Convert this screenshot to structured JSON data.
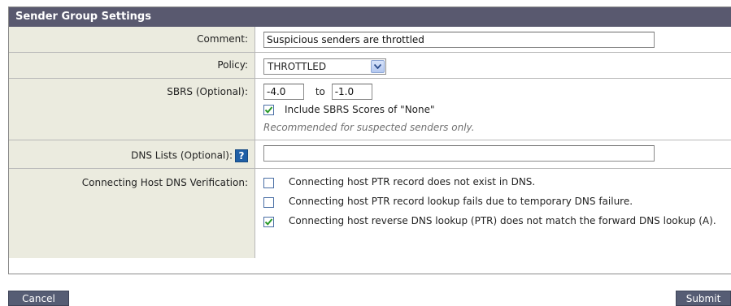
{
  "panel": {
    "title": "Sender Group Settings"
  },
  "comment": {
    "label": "Comment:",
    "value": "Suspicious senders are throttled"
  },
  "policy": {
    "label": "Policy:",
    "value": "THROTTLED"
  },
  "sbrs": {
    "label": "SBRS (Optional):",
    "min": "-4.0",
    "to_label": "to",
    "max": "-1.0",
    "include_none_label": "Include SBRS Scores of \"None\"",
    "include_none_checked": true,
    "hint": "Recommended for suspected senders only."
  },
  "dns_lists": {
    "label": "DNS Lists (Optional):",
    "value": "",
    "help_glyph": "?"
  },
  "host_verification": {
    "label": "Connecting Host DNS Verification:",
    "options": [
      {
        "label": "Connecting host PTR record does not exist in DNS.",
        "checked": false
      },
      {
        "label": "Connecting host PTR record lookup fails due to temporary DNS failure.",
        "checked": false
      },
      {
        "label": "Connecting host reverse DNS lookup (PTR) does not match the forward DNS lookup (A).",
        "checked": true
      }
    ]
  },
  "buttons": {
    "cancel": "Cancel",
    "submit": "Submit"
  },
  "colors": {
    "header": "#59596f",
    "label_bg": "#ebebdf",
    "button": "#565d74",
    "help_icon": "#1f5fa6",
    "check": "#2a9a2a"
  }
}
